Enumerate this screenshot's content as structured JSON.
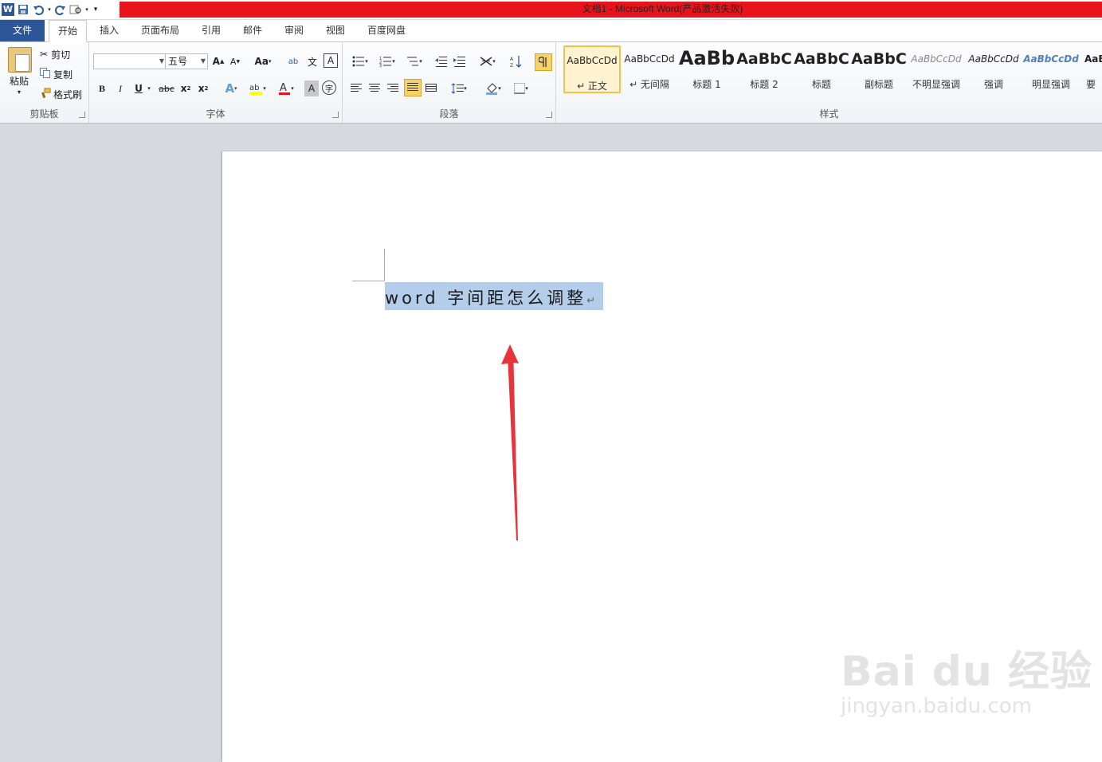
{
  "window": {
    "title": "文档1 - Microsoft Word(产品激活失败)"
  },
  "qat": {
    "app_icon": "W"
  },
  "tabs": [
    "文件",
    "开始",
    "插入",
    "页面布局",
    "引用",
    "邮件",
    "审阅",
    "视图",
    "百度网盘"
  ],
  "clipboard": {
    "paste": "粘贴",
    "cut": "剪切",
    "copy": "复制",
    "format_painter": "格式刷",
    "label": "剪贴板"
  },
  "font": {
    "name_value": "",
    "size_value": "五号",
    "label": "字体"
  },
  "paragraph": {
    "label": "段落"
  },
  "styles": {
    "label": "样式",
    "items": [
      {
        "sample": "AaBbCcDd",
        "name": "↵ 正文"
      },
      {
        "sample": "AaBbCcDd",
        "name": "↵ 无间隔"
      },
      {
        "sample": "AaBb",
        "name": "标题 1"
      },
      {
        "sample": "AaBbC",
        "name": "标题 2"
      },
      {
        "sample": "AaBbC",
        "name": "标题"
      },
      {
        "sample": "AaBbC",
        "name": "副标题"
      },
      {
        "sample": "AaBbCcDd",
        "name": "不明显强调"
      },
      {
        "sample": "AaBbCcDd",
        "name": "强调"
      },
      {
        "sample": "AaBbCcDd",
        "name": "明显强调"
      },
      {
        "sample": "AaB",
        "name": "要"
      }
    ]
  },
  "document": {
    "text": "word 字间距怎么调整",
    "paragraph_mark": "↵"
  },
  "watermark": {
    "brand": "Bai du 经验",
    "url": "jingyan.baidu.com"
  },
  "colors": {
    "title_bar": "#e8141b",
    "file_tab": "#2b579a",
    "selection": "#b3cdea",
    "arrow": "#e8333a"
  }
}
